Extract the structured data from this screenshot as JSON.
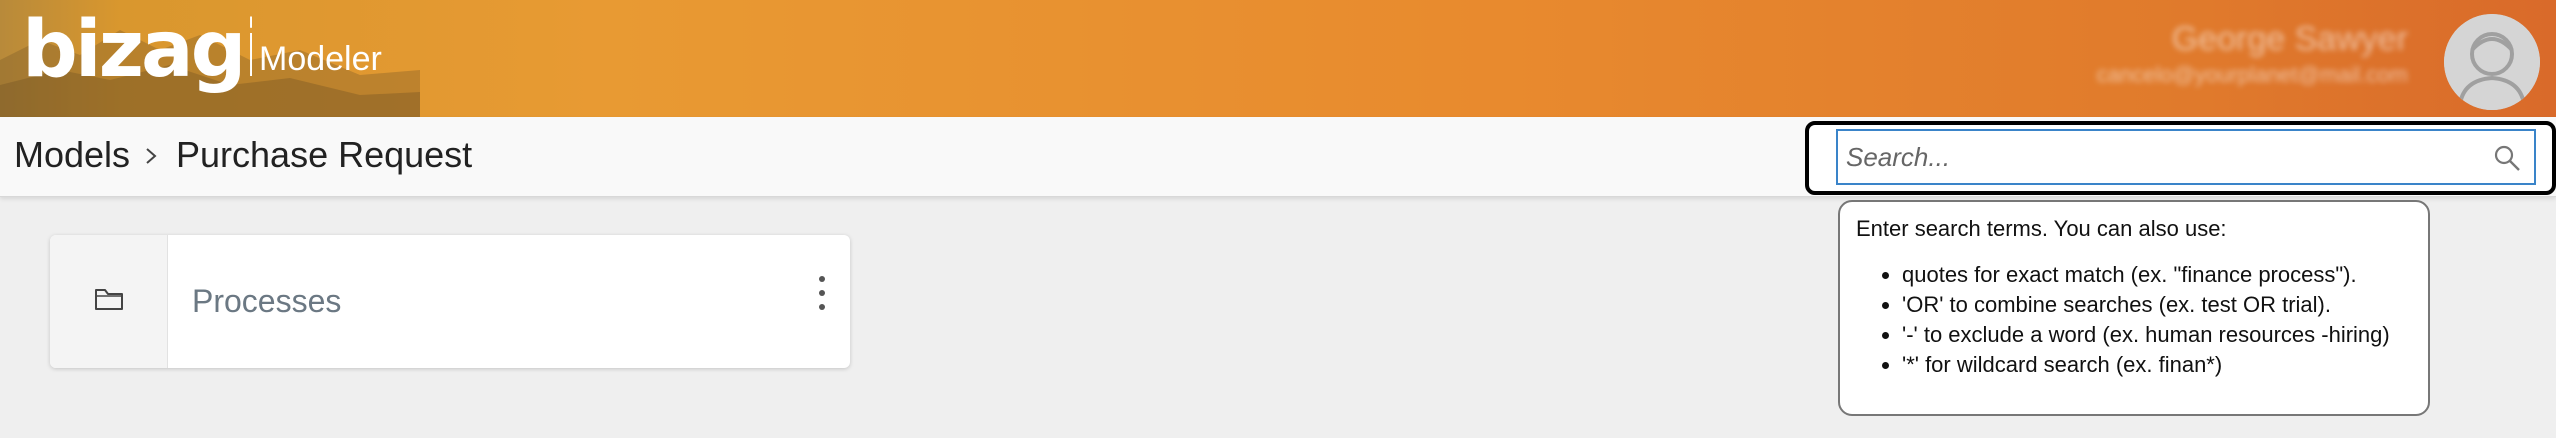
{
  "header": {
    "brand": "bizagi",
    "product": "Modeler",
    "user_name": "George Sawyer",
    "user_email": "cancelo@yourplanet@mail.com"
  },
  "breadcrumb": {
    "root": "Models",
    "separator_icon": "chevron-right-icon",
    "current": "Purchase Request"
  },
  "search": {
    "placeholder": "Search...",
    "value": "",
    "icon": "search-icon"
  },
  "search_help": {
    "intro": "Enter search terms. You can also use:",
    "items": [
      "quotes for exact match (ex. \"finance process\").",
      "'OR' to combine searches (ex. test OR trial).",
      "'-' to exclude a word (ex. human resources -hiring)",
      "'*' for wildcard search (ex. finan*)"
    ]
  },
  "cards": [
    {
      "title": "Processes",
      "icon": "folder-icon",
      "menu_icon": "more-vertical-icon"
    }
  ],
  "colors": {
    "header_orange": "#e8912f",
    "focus_border": "#000000",
    "input_border": "#3a84c9"
  }
}
